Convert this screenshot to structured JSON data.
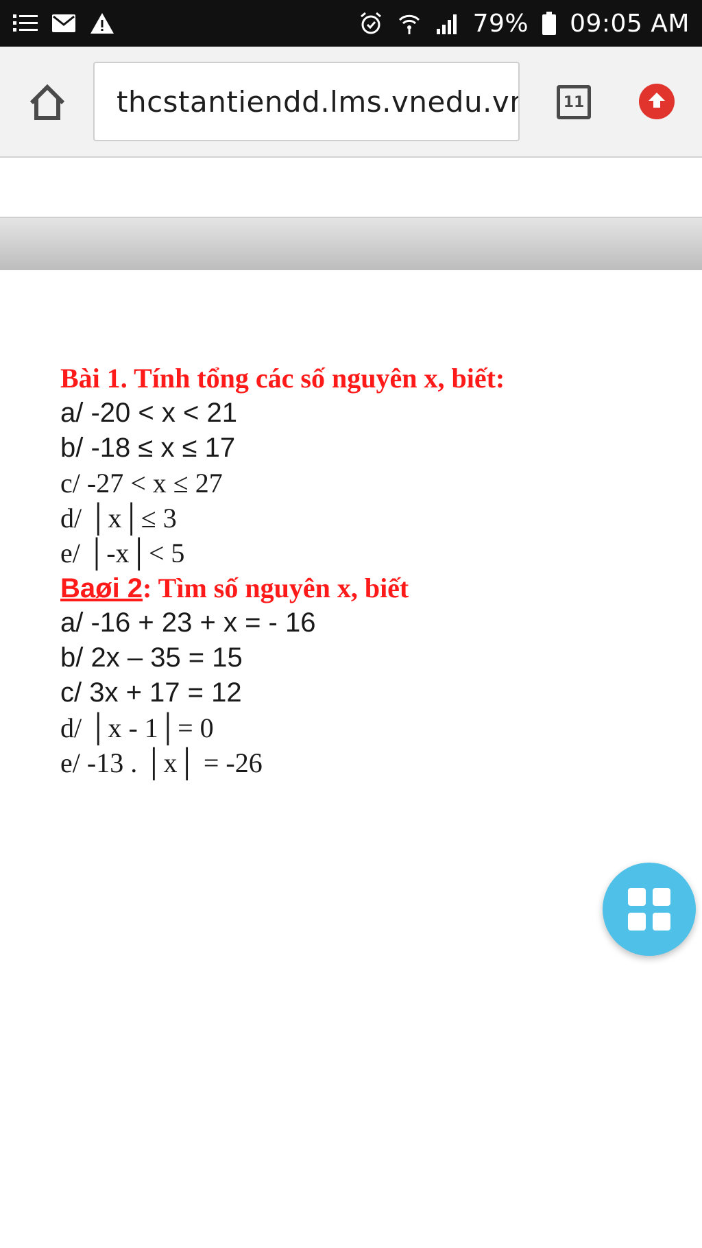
{
  "status_bar": {
    "battery": "79%",
    "time": "09:05 AM"
  },
  "browser": {
    "url": "thcstantiendd.lms.vnedu.vn",
    "tab_count": "11"
  },
  "document": {
    "bai1": {
      "title": "Bài 1. Tính tổng các số nguyên x, biết:",
      "items": [
        "a/ -20 < x < 21",
        "b/ -18 ≤ x ≤ 17",
        "c/ -27 < x ≤ 27",
        "d/ │x│≤ 3",
        "e/ │-x│< 5"
      ]
    },
    "bai2": {
      "title_label": "Baøi 2",
      "title_rest": ":   Tìm số nguyên x, biết",
      "items": [
        "a/ -16 + 23 + x = - 16",
        "b/ 2x – 35 = 15",
        "c/ 3x + 17 = 12",
        "d/ │x - 1│= 0",
        "e/ -13 . │x│ = -26"
      ]
    }
  }
}
